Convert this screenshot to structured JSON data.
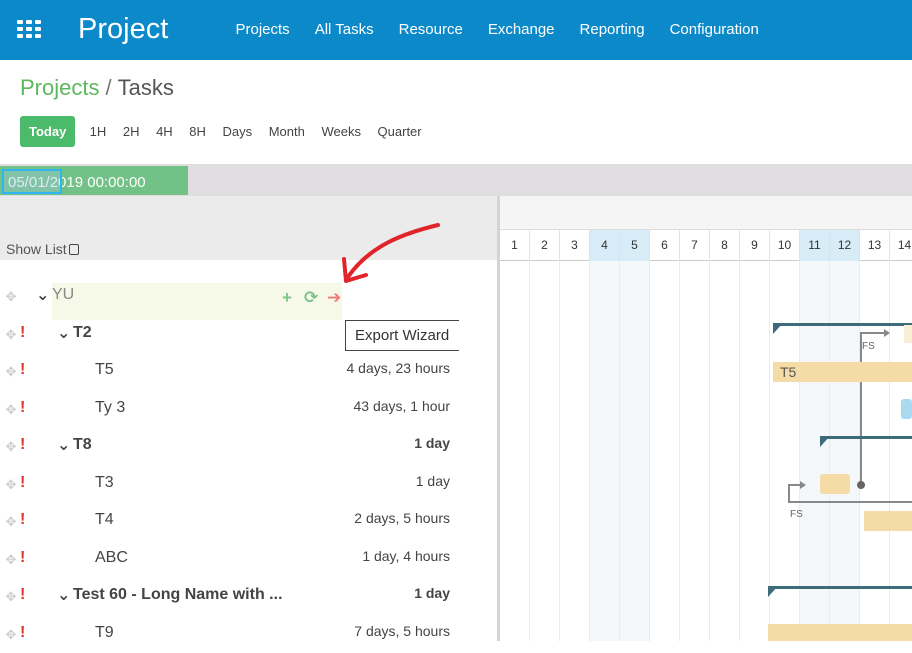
{
  "header": {
    "brand": "Project",
    "nav": [
      "Projects",
      "All Tasks",
      "Resource",
      "Exchange",
      "Reporting",
      "Configuration"
    ]
  },
  "breadcrumb": {
    "parent": "Projects",
    "separator": "/",
    "current": "Tasks"
  },
  "zoom": {
    "today": "Today",
    "scales": [
      "1H",
      "2H",
      "4H",
      "8H",
      "Days",
      "Month",
      "Weeks",
      "Quarter"
    ]
  },
  "date_field": {
    "value": "05/01/2019 00:00:00"
  },
  "show_list": "Show List",
  "tooltip": "Export Wizard",
  "tasks": [
    {
      "name": "YU",
      "duration": "",
      "priority": false
    },
    {
      "name": "T2",
      "duration": "",
      "priority": true
    },
    {
      "name": "T5",
      "duration": "4 days, 23 hours",
      "priority": true
    },
    {
      "name": "Ty 3",
      "duration": "43 days, 1 hour",
      "priority": true
    },
    {
      "name": "T8",
      "duration": "1 day",
      "priority": true
    },
    {
      "name": "T3",
      "duration": "1 day",
      "priority": true
    },
    {
      "name": "T4",
      "duration": "2 days, 5 hours",
      "priority": true
    },
    {
      "name": "ABC",
      "duration": "1 day, 4 hours",
      "priority": true
    },
    {
      "name": "Test 60 - Long Name with ...",
      "duration": "1 day",
      "priority": true
    },
    {
      "name": "T9",
      "duration": "7 days, 5 hours",
      "priority": true
    }
  ],
  "gantt": {
    "days": [
      "1",
      "2",
      "3",
      "4",
      "5",
      "6",
      "7",
      "8",
      "9",
      "10",
      "11",
      "12",
      "13",
      "14"
    ],
    "weekend_days": [
      "4",
      "5",
      "11",
      "12"
    ],
    "bar_labels": {
      "t5": "T5"
    },
    "link_labels": [
      "FS",
      "FS"
    ]
  },
  "colors": {
    "nav_bg": "#0c89c9",
    "accent_green": "#4cba6b",
    "task_bar": "#f5dca7",
    "summary_bar": "#3e6b7a",
    "priority": "#e0342b",
    "annotation": "#e0242a"
  }
}
